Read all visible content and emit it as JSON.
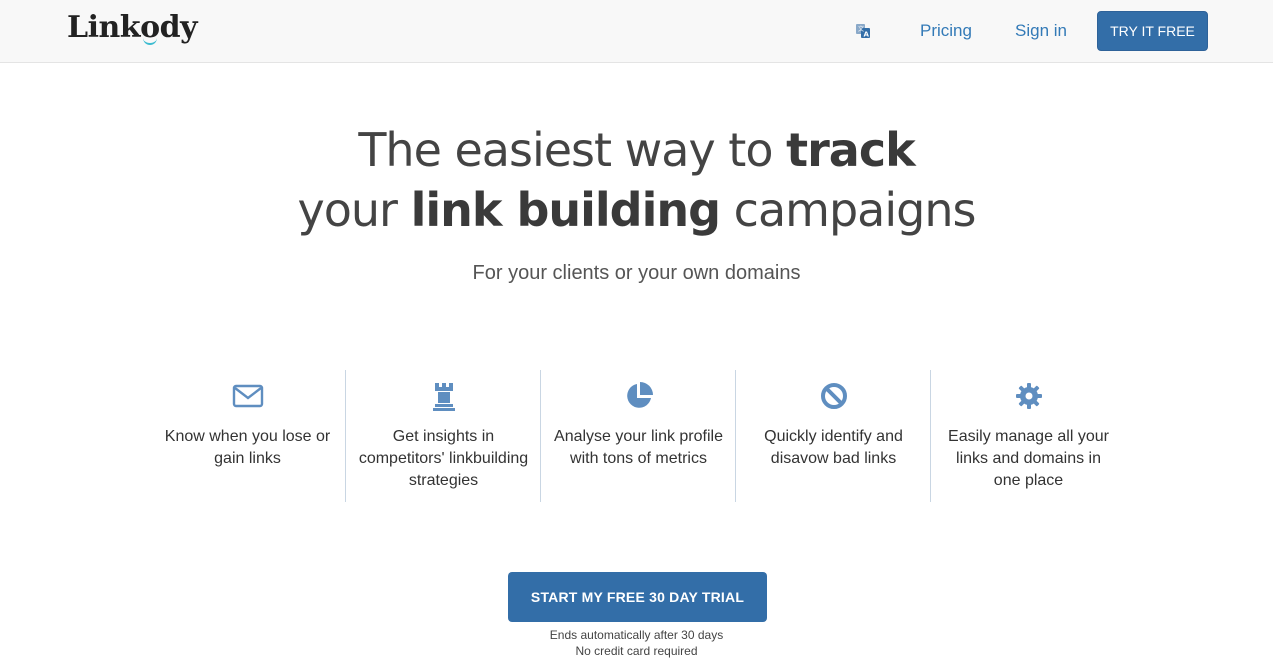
{
  "header": {
    "logo": "Linkody",
    "translate_icon": "translate-icon",
    "links": {
      "pricing": "Pricing",
      "signin": "Sign in"
    },
    "try_button": "TRY IT FREE"
  },
  "hero": {
    "line1_pre": "The easiest way to ",
    "line1_bold": "track",
    "line2_pre": "your ",
    "line2_bold": "link building",
    "line2_post": " campaigns",
    "subtitle": "For your clients or your own domains"
  },
  "features": [
    {
      "icon": "envelope-icon",
      "text": "Know when you lose or gain links"
    },
    {
      "icon": "chess-rook-icon",
      "text": "Get insights in competitors' linkbuilding strategies"
    },
    {
      "icon": "pie-chart-icon",
      "text": "Analyse your link profile with tons of metrics"
    },
    {
      "icon": "ban-icon",
      "text": "Quickly identify and disavow bad links"
    },
    {
      "icon": "gear-icon",
      "text": "Easily manage all your links and domains in one place"
    }
  ],
  "cta": {
    "button": "START MY FREE 30 DAY TRIAL",
    "note1": "Ends automatically after 30 days",
    "note2": "No credit card required"
  },
  "colors": {
    "accent": "#336ea8",
    "link": "#337ab7",
    "icon": "#5f8ec0",
    "logo_smile": "#3dbcd0"
  }
}
